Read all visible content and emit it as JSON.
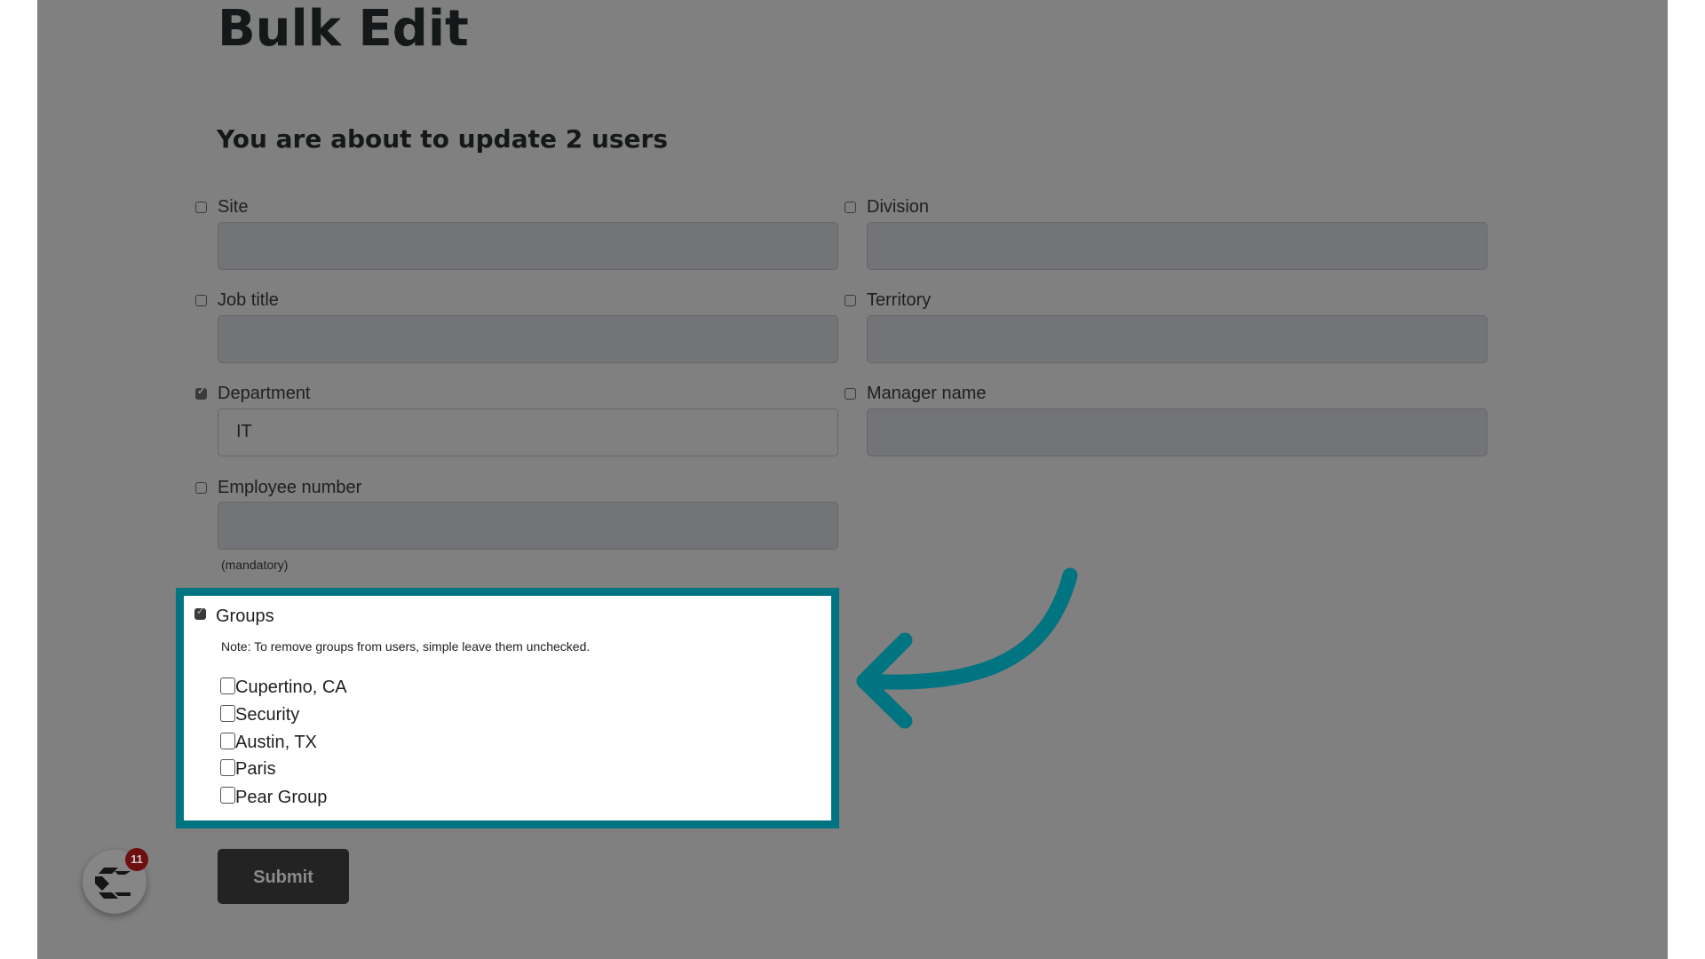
{
  "page": {
    "title": "Bulk Edit",
    "subtitle": "You are about to update 2 users"
  },
  "fields": [
    {
      "label": "Site",
      "checked": false,
      "value": ""
    },
    {
      "label": "Division",
      "checked": false,
      "value": ""
    },
    {
      "label": "Job title",
      "checked": false,
      "value": ""
    },
    {
      "label": "Territory",
      "checked": false,
      "value": ""
    },
    {
      "label": "Department",
      "checked": true,
      "value": "IT"
    },
    {
      "label": "Manager name",
      "checked": false,
      "value": ""
    },
    {
      "label": "Employee number",
      "checked": false,
      "value": "",
      "hint": "(mandatory)"
    }
  ],
  "groups": {
    "label": "Groups",
    "checked": true,
    "note": "Note: To remove groups from users, simple leave them unchecked.",
    "items": [
      {
        "label": "Cupertino, CA",
        "checked": false
      },
      {
        "label": "Security",
        "checked": false
      },
      {
        "label": "Austin, TX",
        "checked": false
      },
      {
        "label": "Paris",
        "checked": false
      },
      {
        "label": "Pear Group",
        "checked": false
      }
    ]
  },
  "submit_label": "Submit",
  "launcher": {
    "icon": "c-logo-icon",
    "badge_count": "11"
  },
  "colors": {
    "highlight": "#007480",
    "overlay": "#808080",
    "badge": "#6e0f0f"
  }
}
